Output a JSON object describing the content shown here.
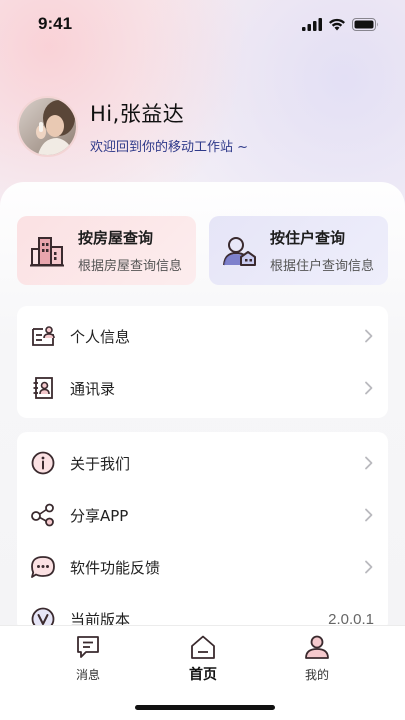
{
  "status_bar": {
    "time": "9:41",
    "icons": [
      "signal-icon",
      "wifi-icon",
      "battery-icon"
    ]
  },
  "profile": {
    "greeting": "Hi,张益达",
    "welcome": "欢迎回到你的移动工作站 ~"
  },
  "quick_actions": [
    {
      "title": "按房屋查询",
      "subtitle": "根据房屋查询信息",
      "icon": "building-icon"
    },
    {
      "title": "按住户查询",
      "subtitle": "根据住户查询信息",
      "icon": "resident-icon"
    }
  ],
  "menu_group_1": [
    {
      "label": "个人信息",
      "icon": "id-card-icon"
    },
    {
      "label": "通讯录",
      "icon": "contacts-icon"
    }
  ],
  "menu_group_2": [
    {
      "label": "关于我们",
      "icon": "info-icon"
    },
    {
      "label": "分享APP",
      "icon": "share-icon"
    },
    {
      "label": "软件功能反馈",
      "icon": "feedback-icon"
    },
    {
      "label": "当前版本",
      "icon": "version-icon",
      "value": "2.0.0.1"
    }
  ],
  "tab_bar": {
    "tabs": [
      {
        "label": "消息",
        "icon": "message-icon"
      },
      {
        "label": "首页",
        "icon": "home-icon",
        "active": true
      },
      {
        "label": "我的",
        "icon": "user-icon"
      }
    ]
  },
  "colors": {
    "accent_pink": "#fbe1e3",
    "accent_purple": "#e6e5f7",
    "icon_dark": "#3a2a2e",
    "icon_pink": "#e8a5ad",
    "icon_blue": "#6b6fc4",
    "welcome_text": "#2f3a8a"
  }
}
